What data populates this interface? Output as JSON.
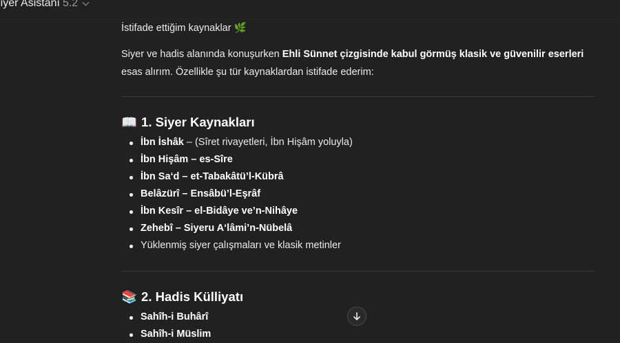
{
  "header": {
    "title": "Siyer Asistanı",
    "version": "5.2",
    "dropdown_icon": "chevron-down-icon"
  },
  "message": {
    "intro_heading": "İstifade ettiğim kaynaklar 🌿",
    "intro_text_1": "Siyer ve hadis alanında konuşurken ",
    "intro_text_bold": "Ehli Sünnet çizgisinde kabul görmüş klasik ve güvenilir eserleri",
    "intro_text_2": " esas alırım. Özellikle şu tür kaynaklardan istifade ederim:",
    "sections": [
      {
        "emoji": "📖",
        "title": "1. Siyer Kaynakları",
        "items": [
          {
            "bold": "İbn İshâk",
            "text": " – (Sîret rivayetleri, İbn Hişâm yoluyla)"
          },
          {
            "bold": "İbn Hişâm – es-Sîre",
            "text": ""
          },
          {
            "bold": "İbn Sa‘d – et-Tabakâtü’l-Kübrâ",
            "text": ""
          },
          {
            "bold": "Belâzürî – Ensâbü’l-Eşrâf",
            "text": ""
          },
          {
            "bold": "İbn Kesîr – el-Bidâye ve’n-Nihâye",
            "text": ""
          },
          {
            "bold": "Zehebî – Siyeru A‘lâmi’n-Nübelâ",
            "text": ""
          },
          {
            "bold": "",
            "text": "Yüklenmiş siyer çalışmaları ve klasik metinler"
          }
        ]
      },
      {
        "emoji": "📚",
        "title": "2. Hadis Külliyatı",
        "items": [
          {
            "bold": "Sahîh-i Buhârî",
            "text": ""
          },
          {
            "bold": "Sahîh-i Müslim",
            "text": ""
          }
        ]
      }
    ]
  },
  "scroll_button": {
    "icon": "arrow-down-icon"
  }
}
